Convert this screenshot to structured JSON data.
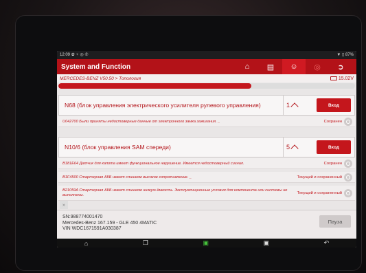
{
  "statusbar": {
    "time": "12:09",
    "left_icons": "✿ ♆ ◎ ✆",
    "right_icons": "▼ ▯ 87%"
  },
  "header": {
    "title": "System and Function"
  },
  "toolbar": {
    "icons": [
      "home-icon",
      "report-icon",
      "person-icon",
      "record-icon",
      "exit-icon"
    ]
  },
  "pathbar": {
    "breadcrumb": "MERCEDES-BENZ V50.50 > Топология",
    "voltage": "15.02V"
  },
  "progress": {
    "fraction": 0.65
  },
  "modules": [
    {
      "name": "N68 (блок управления электрического усилителя рулевого управления)",
      "count": "1",
      "button": "Вход"
    },
    {
      "name": "N10/6 (блок управления SAM спереди)",
      "count": "5",
      "button": "Вход"
    }
  ],
  "dtcs": [
    {
      "text": "U042700 Были приняты недостоверные данные от электронного замка зажигания. _",
      "status": "Сохранен"
    },
    {
      "text": "B181E64 Датчик для капота имеет функциональное нарушение. Имеется недостоверный сигнал.",
      "status": "Сохранен"
    },
    {
      "text": "B1F4500 Стартерная АКБ имеет слишком высокое сопротивление. _",
      "status": "Текущий и сохраненный"
    },
    {
      "text": "B21059A Стартерная АКБ имеет слишком низкую ёмкость. Эксплуатационные условия для компонента или системы не выполнены.",
      "status": "Текущий и сохраненный"
    }
  ],
  "vehicle": {
    "sn": "SN:988774001470",
    "model": "Mercedes-Benz 167.159 - GLE 450 4MATIC",
    "vin": "VIN WDC1671591A030387"
  },
  "pause_label": "Пауза",
  "navbar": {
    "icons": [
      "home-nav-icon",
      "recent-apps-icon",
      "car-diagnostic-icon",
      "screenshot-icon",
      "back-icon"
    ]
  },
  "colors": {
    "accent": "#b3141a",
    "bar": "#c4161c"
  }
}
